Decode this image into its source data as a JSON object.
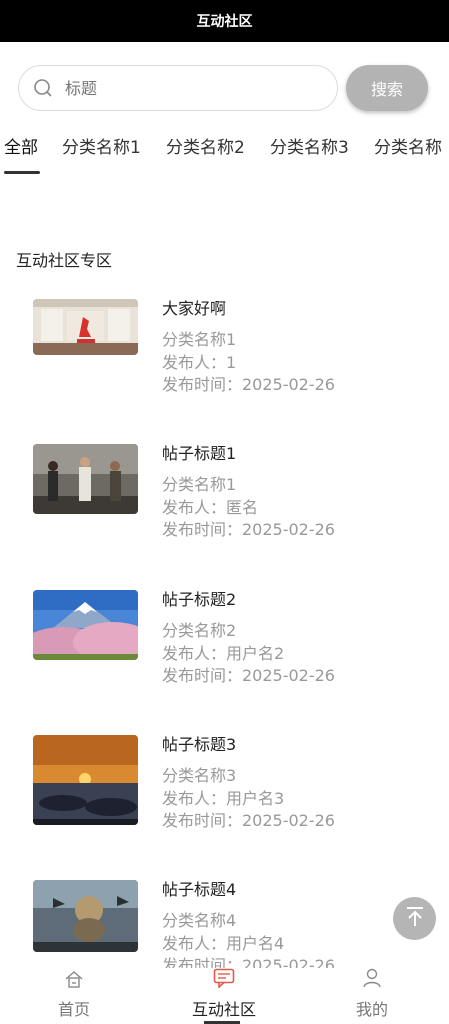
{
  "header": {
    "title": "互动社区"
  },
  "search": {
    "placeholder": "标题",
    "button_label": "搜索"
  },
  "tabs": [
    {
      "label": "全部",
      "active": true
    },
    {
      "label": "分类名称1"
    },
    {
      "label": "分类名称2"
    },
    {
      "label": "分类名称3"
    },
    {
      "label": "分类名称"
    }
  ],
  "section": {
    "title": "互动社区专区"
  },
  "posts": [
    {
      "title": "大家好啊",
      "category": "分类名称1",
      "author": "发布人：1",
      "time": "发布时间：2025-02-26",
      "image": "stage-hall"
    },
    {
      "title": "帖子标题1",
      "category": "分类名称1",
      "author": "发布人：匿名",
      "time": "发布时间：2025-02-26",
      "image": "movie-poster"
    },
    {
      "title": "帖子标题2",
      "category": "分类名称2",
      "author": "发布人：用户名2",
      "time": "发布时间：2025-02-26",
      "image": "fuji-cherry-blossom"
    },
    {
      "title": "帖子标题3",
      "category": "分类名称3",
      "author": "发布人：用户名3",
      "time": "发布时间：2025-02-26",
      "image": "sunset-sea"
    },
    {
      "title": "帖子标题4",
      "category": "分类名称4",
      "author": "发布人：用户名4",
      "time": "发布时间：2025-02-26",
      "image": "fantasy-creatures"
    }
  ],
  "bottom_nav": [
    {
      "label": "首页",
      "icon": "home-icon"
    },
    {
      "label": "互动社区",
      "icon": "chat-icon",
      "active": true
    },
    {
      "label": "我的",
      "icon": "user-icon"
    }
  ],
  "colors": {
    "header_bg": "#000000",
    "button_gray": "#b3b3b3",
    "meta_gray": "#999999",
    "accent_red": "#e05a4f"
  }
}
